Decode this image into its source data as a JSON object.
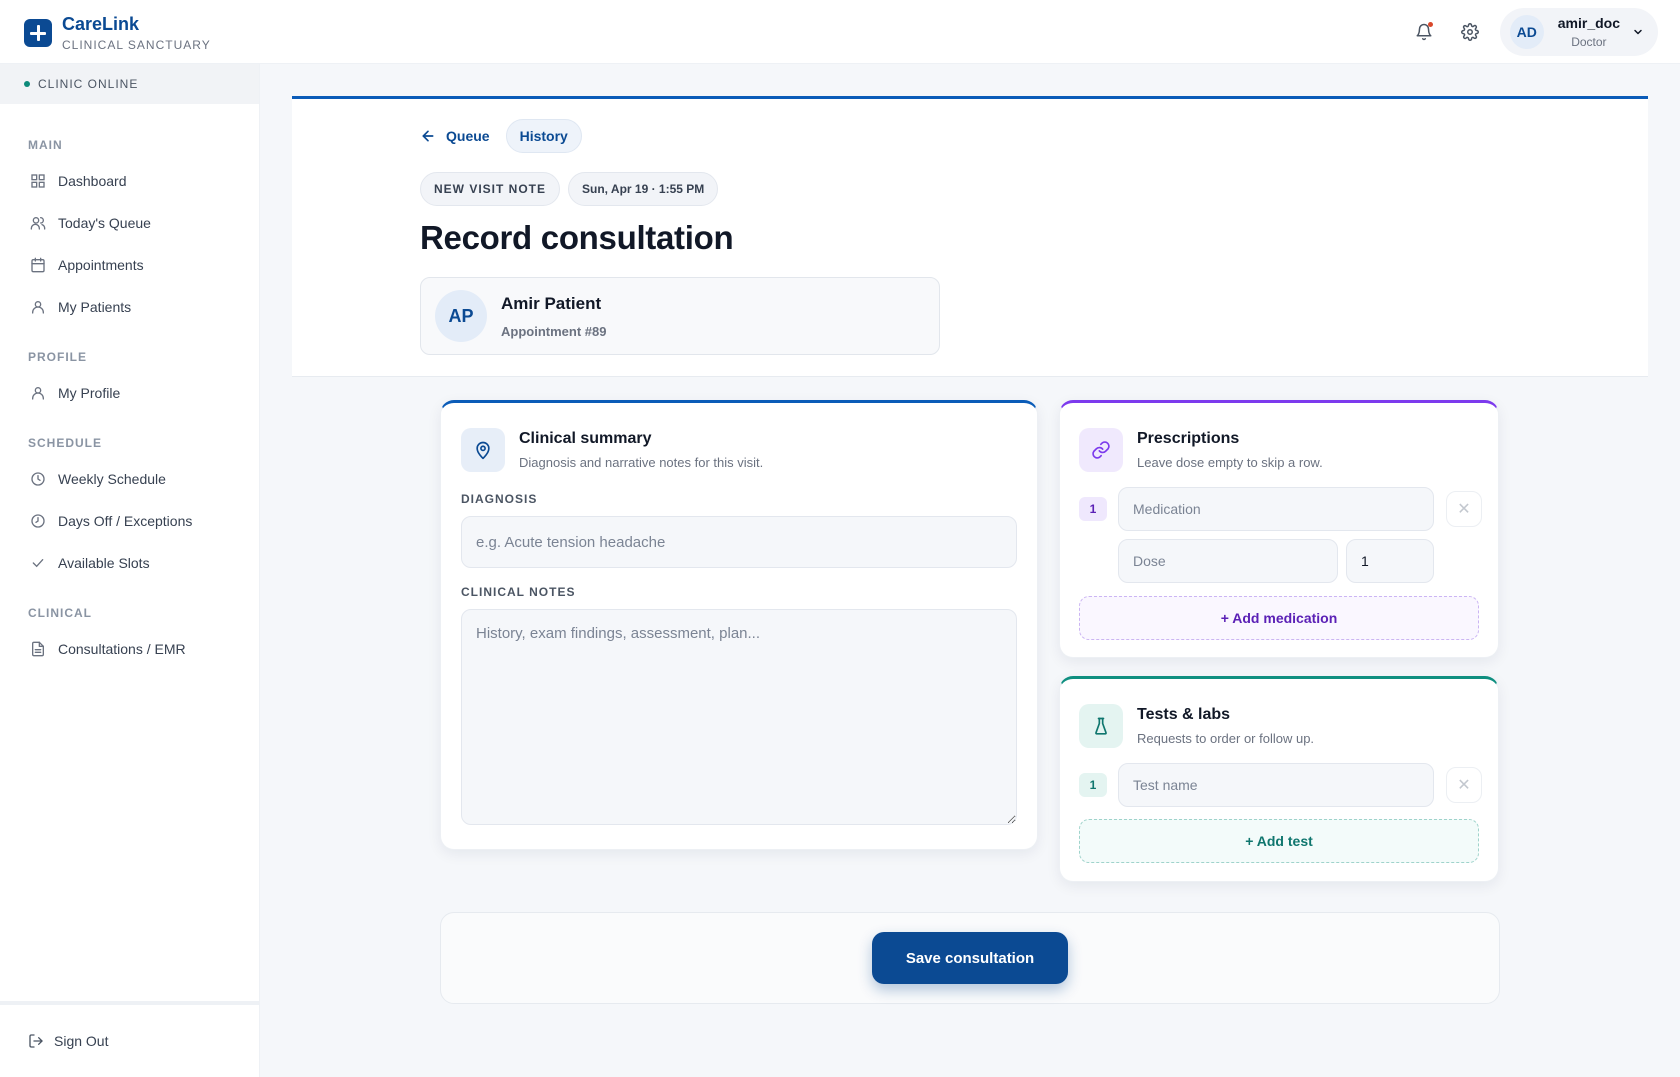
{
  "brand": {
    "name": "CareLink",
    "subtitle": "CLINICAL SANCTUARY"
  },
  "user": {
    "initials": "AD",
    "name": "amir_doc",
    "role": "Doctor"
  },
  "sidebar": {
    "status": "CLINIC ONLINE",
    "sections": [
      {
        "label": "MAIN",
        "items": [
          "Dashboard",
          "Today's Queue",
          "Appointments",
          "My Patients"
        ]
      },
      {
        "label": "PROFILE",
        "items": [
          "My Profile"
        ]
      },
      {
        "label": "SCHEDULE",
        "items": [
          "Weekly Schedule",
          "Days Off / Exceptions",
          "Available Slots"
        ]
      },
      {
        "label": "CLINICAL",
        "items": [
          "Consultations / EMR"
        ]
      }
    ],
    "signout": "Sign Out"
  },
  "header": {
    "back_label": "Queue",
    "history_label": "History",
    "note_type": "NEW VISIT NOTE",
    "datetime": "Sun, Apr 19 · 1:55 PM",
    "title": "Record consultation"
  },
  "patient": {
    "initials": "AP",
    "name": "Amir Patient",
    "appointment": "Appointment #89"
  },
  "clinical_summary": {
    "title": "Clinical summary",
    "subtitle": "Diagnosis and narrative notes for this visit.",
    "diagnosis_label": "DIAGNOSIS",
    "diagnosis_placeholder": "e.g. Acute tension headache",
    "notes_label": "CLINICAL NOTES",
    "notes_placeholder": "History, exam findings, assessment, plan..."
  },
  "prescriptions": {
    "title": "Prescriptions",
    "subtitle": "Leave dose empty to skip a row.",
    "row_number": "1",
    "medication_placeholder": "Medication",
    "dose_placeholder": "Dose",
    "quantity_value": "1",
    "add_label": "+ Add medication"
  },
  "tests": {
    "title": "Tests & labs",
    "subtitle": "Requests to order or follow up.",
    "row_number": "1",
    "test_placeholder": "Test name",
    "add_label": "+ Add test"
  },
  "footer": {
    "save_label": "Save consultation"
  },
  "colors": {
    "primary": "#0b4a93",
    "accent_blue": "#0b5cb8",
    "accent_purple": "#7c3aed",
    "accent_teal": "#0f8f80",
    "online": "#0d8a7a"
  }
}
